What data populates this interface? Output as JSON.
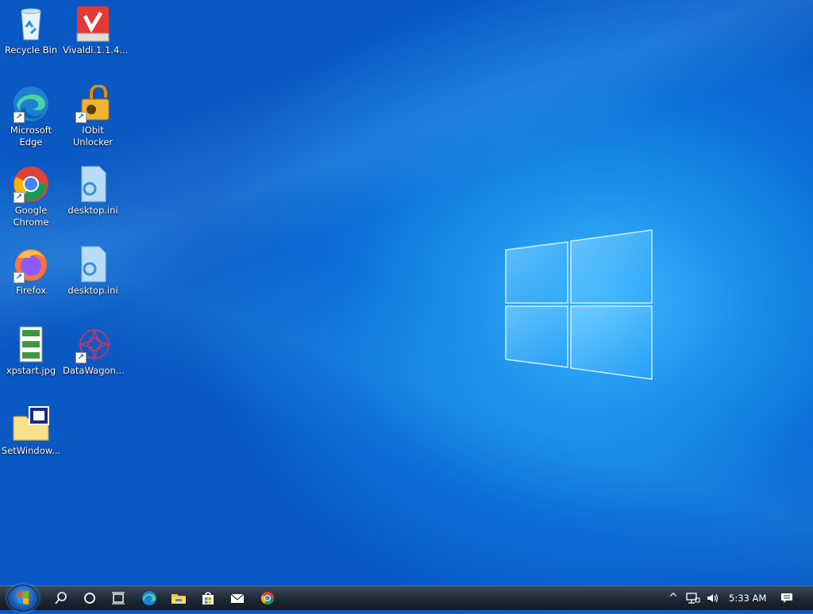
{
  "desktop": {
    "icons": [
      {
        "label": "Recycle Bin",
        "icon": "recycle-bin-icon"
      },
      {
        "label": "Vivaldi.1.1.4...",
        "icon": "vivaldi-installer-icon"
      },
      {
        "label": "Microsoft Edge",
        "icon": "edge-icon"
      },
      {
        "label": "IObit Unlocker",
        "icon": "iobit-unlocker-icon"
      },
      {
        "label": "Google Chrome",
        "icon": "chrome-icon"
      },
      {
        "label": "desktop.ini",
        "icon": "ini-file-icon"
      },
      {
        "label": "Firefox",
        "icon": "firefox-icon"
      },
      {
        "label": "desktop.ini",
        "icon": "ini-file-icon"
      },
      {
        "label": "xpstart.jpg",
        "icon": "image-file-icon"
      },
      {
        "label": "DataWagon...",
        "icon": "datawagon-icon"
      },
      {
        "label": "SetWindow...",
        "icon": "folder-app-icon"
      }
    ],
    "wallpaper": "windows-10-hero",
    "accent": "#0b6fd8"
  },
  "taskbar": {
    "start": "start-button",
    "pinned": [
      "search-icon",
      "cortana-icon",
      "task-view-icon",
      "edge-icon",
      "file-explorer-icon",
      "store-icon",
      "mail-icon",
      "chrome-icon"
    ],
    "tray": {
      "chevron": "^",
      "clock": "5:33 AM"
    }
  }
}
